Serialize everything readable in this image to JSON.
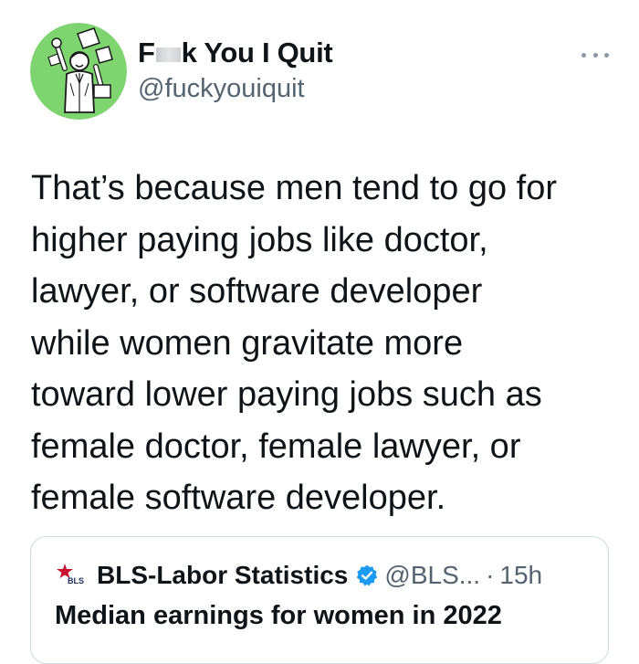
{
  "author": {
    "name_prefix": "F",
    "name_suffix": "k You I Quit",
    "handle": "@fuckyouiquit",
    "avatar_icon": "man-quitting-illustration",
    "avatar_bg": "#7ed56f"
  },
  "tweet": {
    "lines": [
      "That’s because men tend to go for",
      "higher paying jobs like doctor,",
      "lawyer, or software developer",
      "while women gravitate more",
      "toward lower paying jobs such as",
      "female doctor, female lawyer, or",
      "female software developer."
    ]
  },
  "quoted": {
    "logo_text": "BLS",
    "name": "BLS-Labor Statistics",
    "handle": "@BLS...",
    "separator": "·",
    "time": "15h",
    "text": "Median earnings for women in 2022",
    "verified_color": "#1d9bf0"
  },
  "icons": {
    "more": "more-horizontal-icon",
    "verified": "verified-badge-icon"
  }
}
